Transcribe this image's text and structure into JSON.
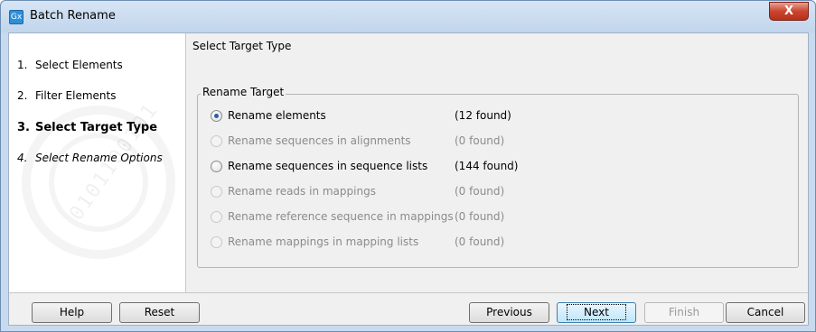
{
  "window": {
    "title": "Batch Rename",
    "icon_text": "Gx",
    "close_label": "X"
  },
  "steps": [
    {
      "num": "1.",
      "label": "Select Elements",
      "state": "done"
    },
    {
      "num": "2.",
      "label": "Filter Elements",
      "state": "done"
    },
    {
      "num": "3.",
      "label": "Select Target Type",
      "state": "current"
    },
    {
      "num": "4.",
      "label": "Select Rename Options",
      "state": "next"
    }
  ],
  "watermark_text": "0101100101",
  "content": {
    "title": "Select Target Type",
    "group_title": "Rename Target",
    "options": [
      {
        "label": "Rename elements",
        "count": "(12 found)",
        "checked": true,
        "enabled": true
      },
      {
        "label": "Rename sequences in alignments",
        "count": "(0 found)",
        "checked": false,
        "enabled": false
      },
      {
        "label": "Rename sequences in sequence lists",
        "count": "(144 found)",
        "checked": false,
        "enabled": true
      },
      {
        "label": "Rename reads in mappings",
        "count": "(0 found)",
        "checked": false,
        "enabled": false
      },
      {
        "label": "Rename reference sequence in mappings",
        "count": "(0 found)",
        "checked": false,
        "enabled": false
      },
      {
        "label": "Rename mappings in mapping lists",
        "count": "(0 found)",
        "checked": false,
        "enabled": false
      }
    ]
  },
  "buttons": {
    "help": "Help",
    "reset": "Reset",
    "previous": "Previous",
    "next": "Next",
    "finish": "Finish",
    "cancel": "Cancel"
  }
}
